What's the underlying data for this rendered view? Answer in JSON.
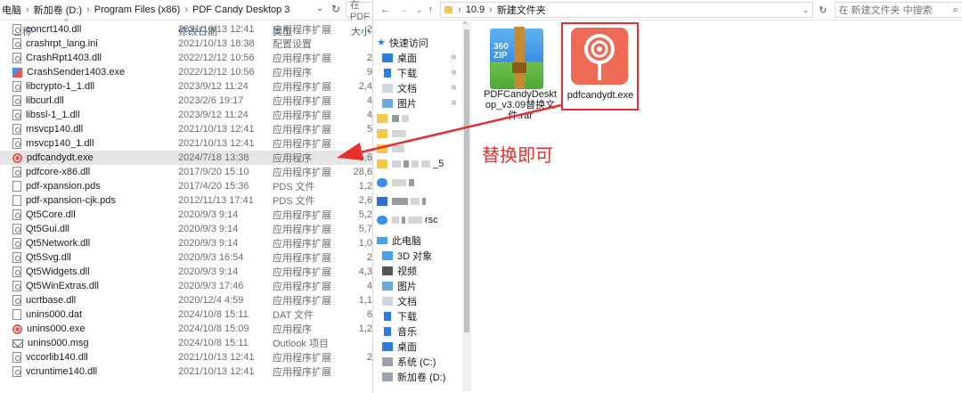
{
  "left": {
    "breadcrumb": [
      "电脑",
      "新加卷 (D:)",
      "Program Files (x86)",
      "PDF Candy Desktop 3"
    ],
    "search_placeholder": "在 PDF",
    "columns": {
      "name": "名称",
      "date": "修改日期",
      "type": "类型",
      "size": "大小"
    },
    "files": [
      {
        "name": "concrt140.dll",
        "date": "2021/10/13 12:41",
        "type": "应用程序扩展",
        "size": "2",
        "icon": "gear-file"
      },
      {
        "name": "crashrpt_lang.ini",
        "date": "2021/10/13 18:38",
        "type": "配置设置",
        "size": "",
        "icon": "gear-file"
      },
      {
        "name": "CrashRpt1403.dll",
        "date": "2022/12/12 10:56",
        "type": "应用程序扩展",
        "size": "2",
        "icon": "gear-file"
      },
      {
        "name": "CrashSender1403.exe",
        "date": "2022/12/12 10:56",
        "type": "应用程序",
        "size": "9",
        "icon": "exe"
      },
      {
        "name": "libcrypto-1_1.dll",
        "date": "2023/9/12 11:24",
        "type": "应用程序扩展",
        "size": "2,4",
        "icon": "gear-file"
      },
      {
        "name": "libcurl.dll",
        "date": "2023/2/6 19:17",
        "type": "应用程序扩展",
        "size": "4",
        "icon": "gear-file"
      },
      {
        "name": "libssl-1_1.dll",
        "date": "2023/9/12 11:24",
        "type": "应用程序扩展",
        "size": "4",
        "icon": "gear-file"
      },
      {
        "name": "msvcp140.dll",
        "date": "2021/10/13 12:41",
        "type": "应用程序扩展",
        "size": "5",
        "icon": "gear-file"
      },
      {
        "name": "msvcp140_1.dll",
        "date": "2021/10/13 12:41",
        "type": "应用程序扩展",
        "size": "",
        "icon": "gear-file"
      },
      {
        "name": "pdfcandydt.exe",
        "date": "2024/7/18 13:38",
        "type": "应用程序",
        "size": "5,6",
        "icon": "candy"
      },
      {
        "name": "pdfcore-x86.dll",
        "date": "2017/9/20 15:10",
        "type": "应用程序扩展",
        "size": "28,6",
        "icon": "gear-file"
      },
      {
        "name": "pdf-xpansion.pds",
        "date": "2017/4/20 15:36",
        "type": "PDS 文件",
        "size": "1,2",
        "icon": "file"
      },
      {
        "name": "pdf-xpansion-cjk.pds",
        "date": "2012/11/13 17:41",
        "type": "PDS 文件",
        "size": "2,6",
        "icon": "file"
      },
      {
        "name": "Qt5Core.dll",
        "date": "2020/9/3 9:14",
        "type": "应用程序扩展",
        "size": "5,2",
        "icon": "gear-file"
      },
      {
        "name": "Qt5Gui.dll",
        "date": "2020/9/3 9:14",
        "type": "应用程序扩展",
        "size": "5,7",
        "icon": "gear-file"
      },
      {
        "name": "Qt5Network.dll",
        "date": "2020/9/3 9:14",
        "type": "应用程序扩展",
        "size": "1,0",
        "icon": "gear-file"
      },
      {
        "name": "Qt5Svg.dll",
        "date": "2020/9/3 16:54",
        "type": "应用程序扩展",
        "size": "2",
        "icon": "gear-file"
      },
      {
        "name": "Qt5Widgets.dll",
        "date": "2020/9/3 9:14",
        "type": "应用程序扩展",
        "size": "4,3",
        "icon": "gear-file"
      },
      {
        "name": "Qt5WinExtras.dll",
        "date": "2020/9/3 17:46",
        "type": "应用程序扩展",
        "size": "4",
        "icon": "gear-file"
      },
      {
        "name": "ucrtbase.dll",
        "date": "2020/12/4 4:59",
        "type": "应用程序扩展",
        "size": "1,1",
        "icon": "gear-file"
      },
      {
        "name": "unins000.dat",
        "date": "2024/10/8 15:11",
        "type": "DAT 文件",
        "size": "6",
        "icon": "file"
      },
      {
        "name": "unins000.exe",
        "date": "2024/10/8 15:09",
        "type": "应用程序",
        "size": "1,2",
        "icon": "candy"
      },
      {
        "name": "unins000.msg",
        "date": "2024/10/8 15:11",
        "type": "Outlook 项目",
        "size": "",
        "icon": "mail"
      },
      {
        "name": "vccorlib140.dll",
        "date": "2021/10/13 12:41",
        "type": "应用程序扩展",
        "size": "2",
        "icon": "gear-file"
      },
      {
        "name": "vcruntime140.dll",
        "date": "2021/10/13 12:41",
        "type": "应用程序扩展",
        "size": "",
        "icon": "gear-file"
      }
    ]
  },
  "right": {
    "breadcrumb": [
      "10.9",
      "新建文件夹"
    ],
    "search_placeholder": "在 新建文件夹 中搜索",
    "nav": {
      "quick_access": "快速访问",
      "quick_items": [
        {
          "label": "桌面",
          "icon": "desktop-icon"
        },
        {
          "label": "下载",
          "icon": "download-icon"
        },
        {
          "label": "文档",
          "icon": "document-icon"
        },
        {
          "label": "图片",
          "icon": "picture-icon"
        }
      ],
      "partial_text_1": "_5",
      "partial_text_2": "rsc",
      "this_pc": "此电脑",
      "pc_items": [
        {
          "label": "3D 对象",
          "icon": "cube-icon"
        },
        {
          "label": "视频",
          "icon": "video-icon"
        },
        {
          "label": "图片",
          "icon": "picture-icon"
        },
        {
          "label": "文档",
          "icon": "document-icon"
        },
        {
          "label": "下载",
          "icon": "download-icon"
        },
        {
          "label": "音乐",
          "icon": "music-icon"
        },
        {
          "label": "桌面",
          "icon": "desktop-icon"
        },
        {
          "label": "系统 (C:)",
          "icon": "drive-icon"
        },
        {
          "label": "新加卷 (D:)",
          "icon": "drive-icon"
        }
      ]
    },
    "tiles": [
      {
        "name": "PDFCandyDesktop_v3.09替换文件.rar",
        "line1": "PDFCandyDeskt",
        "line2": "op_v3.09替换文",
        "line3": "件.rar",
        "icon_text_1": "360",
        "icon_text_2": "ZIP"
      },
      {
        "name": "pdfcandydt.exe"
      }
    ],
    "annotation": "替换即可",
    "annotation_color": "#e5302f"
  }
}
